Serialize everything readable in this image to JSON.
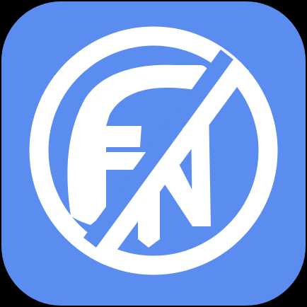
{
  "app_icon": {
    "logo_text": "FN",
    "icon": "fn-logo-icon",
    "colors": {
      "tile": "#5B8DF0",
      "mark": "#FFFFFF",
      "page": "#000000"
    }
  }
}
